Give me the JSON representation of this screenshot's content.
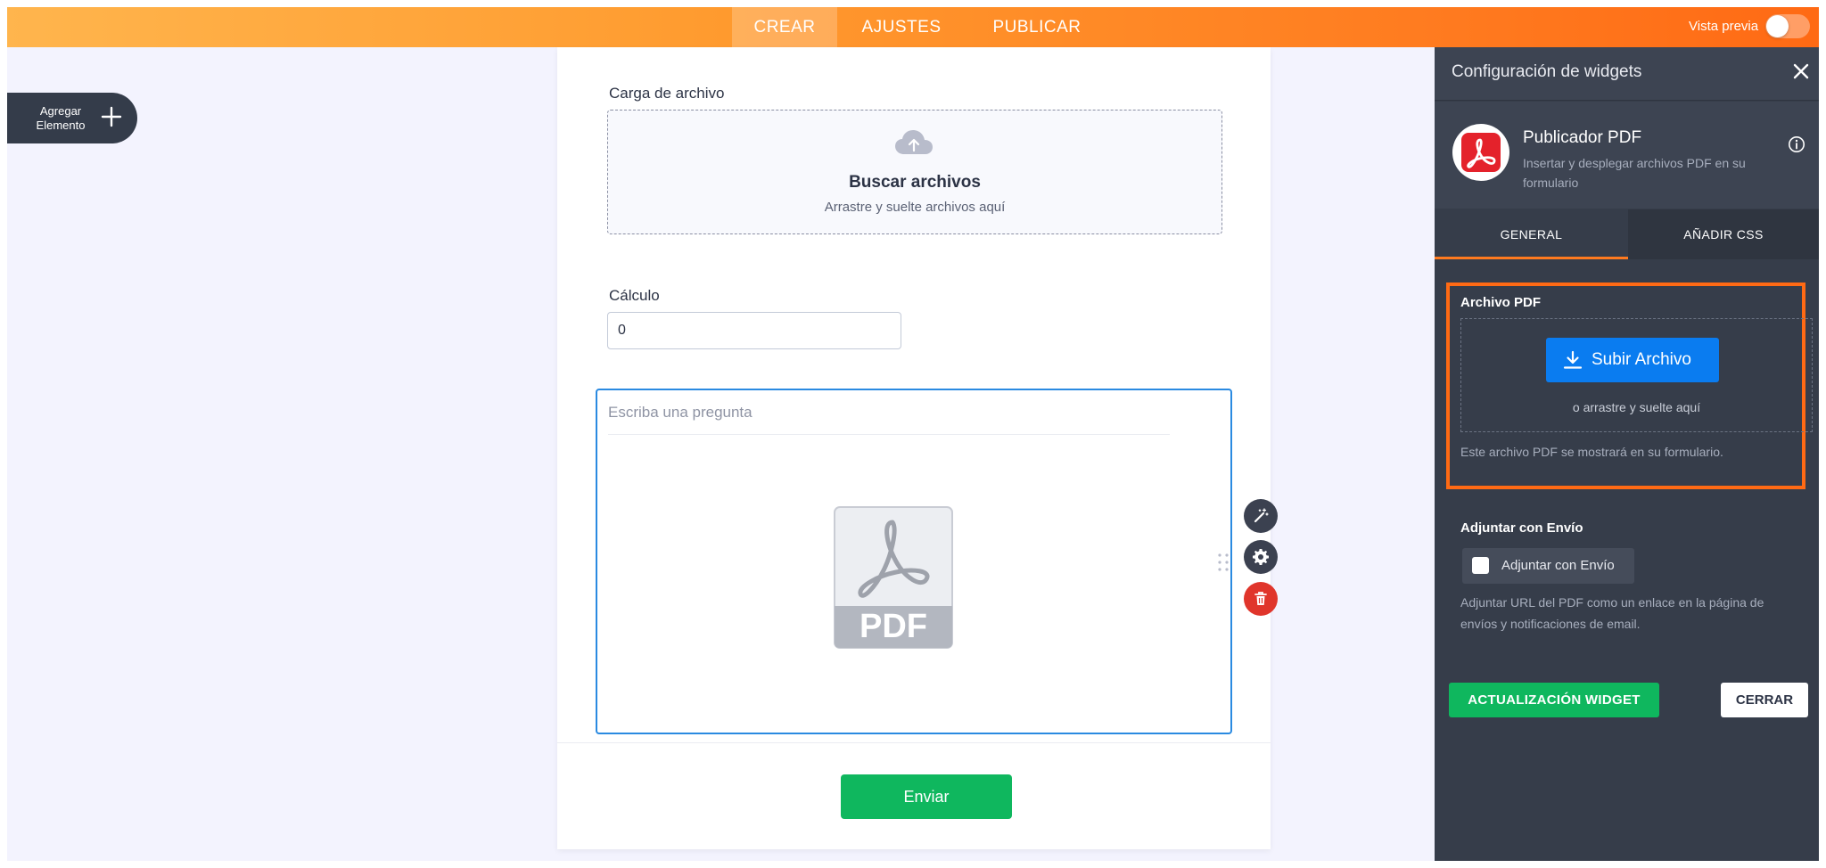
{
  "topbar": {
    "tabs": [
      {
        "label": "CREAR",
        "active": true
      },
      {
        "label": "AJUSTES",
        "active": false
      },
      {
        "label": "PUBLICAR",
        "active": false
      }
    ],
    "preview_label": "Vista previa",
    "preview_enabled": false
  },
  "add_element": {
    "label": "Agregar Elemento"
  },
  "form": {
    "upload": {
      "label": "Carga de archivo",
      "title": "Buscar archivos",
      "subtitle": "Arrastre y suelte archivos aquí"
    },
    "calculation": {
      "label": "Cálculo",
      "value": "0"
    },
    "pdf_field": {
      "question_placeholder": "Escriba una pregunta",
      "doc_label": "PDF"
    },
    "submit_label": "Enviar"
  },
  "panel": {
    "title": "Configuración de widgets",
    "widget": {
      "name": "Publicador PDF",
      "description": "Insertar y desplegar archivos PDF en su formulario"
    },
    "tabs": [
      {
        "label": "GENERAL",
        "active": true
      },
      {
        "label": "AÑADIR CSS",
        "active": false
      }
    ],
    "pdf_section": {
      "label": "Archivo PDF",
      "upload_button": "Subir Archivo",
      "drop_hint": "o arrastre y suelte aquí",
      "hint": "Este archivo PDF se mostrará en su formulario."
    },
    "attach": {
      "label": "Adjuntar con Envío",
      "checkbox_label": "Adjuntar con Envío",
      "checked": false,
      "description": "Adjuntar URL del PDF como un enlace en la página de envíos y notificaciones de email."
    },
    "update_button": "ACTUALIZACIÓN WIDGET",
    "close_button": "CERRAR"
  },
  "colors": {
    "accent_orange": "#ff7a1f",
    "submit_green": "#0fb75e",
    "upload_blue": "#0a7cf0",
    "delete_red": "#e0352b",
    "panel_bg": "#363d4a"
  }
}
